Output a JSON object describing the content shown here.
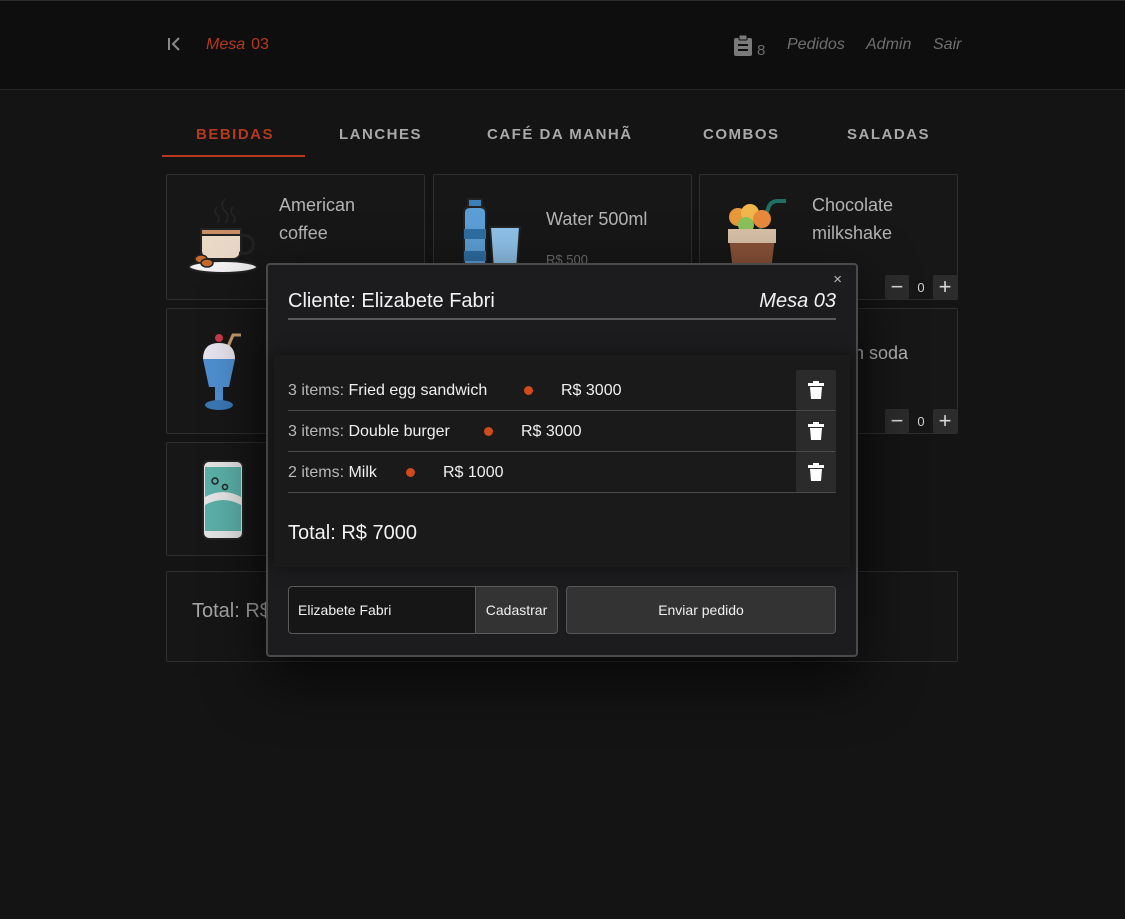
{
  "header": {
    "mesa_word": "Mesa",
    "mesa_number": "03",
    "orders_count": "8",
    "nav": [
      "Pedidos",
      "Admin",
      "Sair"
    ],
    "accent_color": "#b5391c"
  },
  "tabs": [
    "Bebidas",
    "Lanches",
    "Café da manhã",
    "Combos",
    "Saladas"
  ],
  "active_tab": "Bebidas",
  "products": [
    {
      "name_line1": "American",
      "name_line2": "coffee",
      "icon": "coffee-cup-icon"
    },
    {
      "name_line1": "Water 500ml",
      "price": "R$ 500",
      "icon": "water-bottle-icon"
    },
    {
      "name_line1": "Chocolate",
      "name_line2": "milkshake",
      "quantity": "0",
      "icon": "milkshake-icon"
    },
    {
      "icon": "milkshake-glass-icon"
    },
    {
      "name_partial": "n soda",
      "quantity": "0"
    },
    {
      "icon": "soda-can-icon"
    }
  ],
  "page_total_partial": "Total: R$",
  "modal": {
    "close_glyph": "×",
    "client_label": "Cliente: Elizabete Fabri",
    "mesa_label": "Mesa 03",
    "items": [
      {
        "qty": "3 items:",
        "name": "Fried egg sandwich",
        "price": "R$ 3000"
      },
      {
        "qty": "3 items:",
        "name": "Double burger",
        "price": "R$ 3000"
      },
      {
        "qty": "2 items:",
        "name": "Milk",
        "price": "R$ 1000"
      }
    ],
    "total": "Total: R$ 7000",
    "client_input_value": "Elizabete Fabri",
    "register_label": "Cadastrar",
    "send_label": "Enviar pedido"
  }
}
